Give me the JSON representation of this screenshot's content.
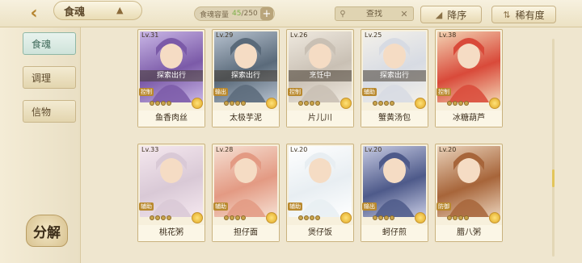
{
  "header": {
    "title": "食魂",
    "capacity_label": "食魂容量",
    "capacity_current": "45",
    "capacity_total": "/250",
    "search_placeholder": "查找",
    "sort_desc_label": "降序",
    "sort_rarity_label": "稀有度"
  },
  "sidebar": {
    "items": [
      {
        "label": "食魂"
      },
      {
        "label": "调理"
      },
      {
        "label": "信物"
      }
    ],
    "decompose_label": "分解"
  },
  "cards": [
    {
      "level": "Lv.31",
      "name": "鱼香肉丝",
      "status": "探索出行",
      "tag": "控制",
      "stars": 4
    },
    {
      "level": "Lv.29",
      "name": "太极芋泥",
      "status": "探索出行",
      "tag": "输出",
      "stars": 4
    },
    {
      "level": "Lv.26",
      "name": "片儿川",
      "status": "烹饪中",
      "tag": "控制",
      "stars": 4
    },
    {
      "level": "Lv.25",
      "name": "蟹黄汤包",
      "status": "探索出行",
      "tag": "辅助",
      "stars": 4
    },
    {
      "level": "Lv.38",
      "name": "冰糖葫芦",
      "status": "",
      "tag": "控制",
      "stars": 4
    },
    {
      "level": "Lv.33",
      "name": "桃花粥",
      "status": "",
      "tag": "辅助",
      "stars": 4
    },
    {
      "level": "Lv.28",
      "name": "担仔面",
      "status": "",
      "tag": "辅助",
      "stars": 4
    },
    {
      "level": "Lv.20",
      "name": "煲仔饭",
      "status": "",
      "tag": "辅助",
      "stars": 4
    },
    {
      "level": "Lv.20",
      "name": "蚵仔煎",
      "status": "",
      "tag": "输出",
      "stars": 4
    },
    {
      "level": "Lv.20",
      "name": "腊八粥",
      "status": "",
      "tag": "防御",
      "stars": 4
    }
  ],
  "colors": {
    "accent": "#b58430",
    "active_tab": "#cfe3da",
    "capacity_highlight": "#7fb04b"
  }
}
